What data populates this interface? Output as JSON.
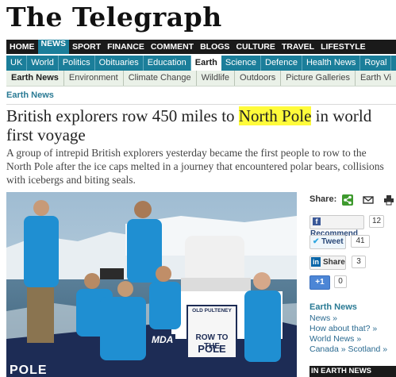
{
  "masthead": {
    "logo": "The Telegraph"
  },
  "nav_primary": [
    "HOME",
    "NEWS",
    "SPORT",
    "FINANCE",
    "COMMENT",
    "BLOGS",
    "CULTURE",
    "TRAVEL",
    "LIFESTYLE"
  ],
  "nav_secondary": [
    "UK",
    "World",
    "Politics",
    "Obituaries",
    "Education",
    "Earth",
    "Science",
    "Defence",
    "Health News",
    "Royal"
  ],
  "nav_tertiary": [
    "Earth News",
    "Environment",
    "Climate Change",
    "Wildlife",
    "Outdoors",
    "Picture Galleries",
    "Earth Vi"
  ],
  "breadcrumb": "Earth News",
  "article": {
    "headline_pre": "British explorers row 450 miles to ",
    "headline_highlight": "North Pole",
    "headline_post": " in world first voyage",
    "standfirst": "A group of intrepid British explorers yesterday became the first people to row to the North Pole after the ice caps melted in a journey that encountered polar bears, collisions with icebergs and biting seals."
  },
  "photo": {
    "boat_name_sign": "OLD PULTENEY",
    "boat_banner_line1": "ROW TO THE",
    "boat_banner_line2": "POLE",
    "sponsor": "MDA",
    "hull_text": "POLE"
  },
  "sidebar": {
    "share_label": "Share:",
    "facebook": {
      "label": "Recommend",
      "count": "12"
    },
    "twitter": {
      "label": "Tweet",
      "count": "41"
    },
    "linkedin": {
      "label": "Share",
      "count": "3"
    },
    "google": {
      "label": "+1",
      "count": "0"
    },
    "earth_news_title": "Earth News",
    "links": [
      "News »",
      "How about that? »",
      "World News »",
      "Canada »  Scotland »"
    ],
    "in_earth_news": "IN EARTH NEWS"
  },
  "colors": {
    "brand_teal": "#1b7e9a",
    "nav_dark": "#1a1a1a",
    "highlight": "#fffb3a"
  }
}
